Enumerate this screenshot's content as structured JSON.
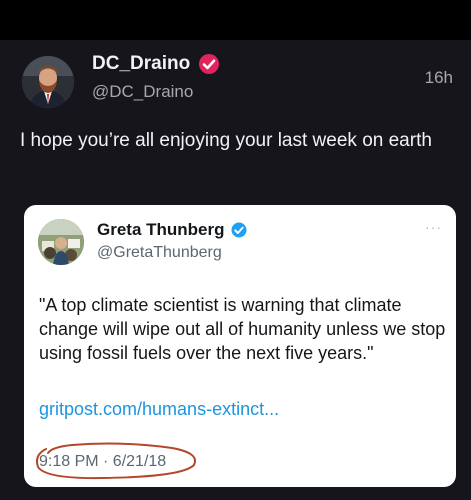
{
  "post": {
    "author_name": "DC_Draino",
    "author_handle": "@DC_Draino",
    "timestamp": "16h",
    "text": "I hope you’re all enjoying your last week on earth",
    "verified_badge_color": "#e0245e"
  },
  "quoted": {
    "author_name": "Greta Thunberg",
    "author_handle": "@GretaThunberg",
    "more_label": "···",
    "text": "\"A top climate scientist is warning that climate change will wipe out all of humanity unless we stop using fossil fuels over the next five years.\"",
    "link": "gritpost.com/humans-extinct...",
    "timestamp": "9:18 PM · 6/21/18",
    "verified_badge_color": "#1da1f2",
    "annotation_color": "#b5462a"
  }
}
